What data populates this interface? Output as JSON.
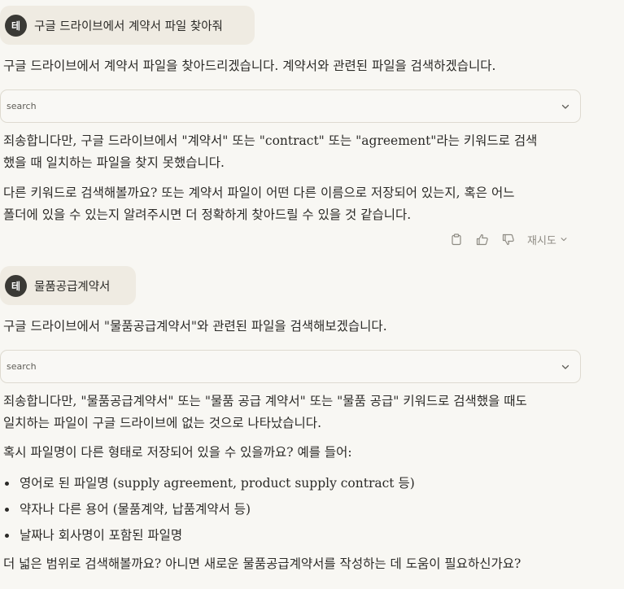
{
  "conversation": {
    "user_avatar_initial": "테",
    "turn1": {
      "user_message": "구글 드라이브에서 계약서 파일 찾아줘",
      "intro": "구글 드라이브에서 계약서 파일을 찾아드리겠습니다. 계약서와 관련된 파일을 검색하겠습니다.",
      "tool_label": "search",
      "result_line1": "죄송합니다만, 구글 드라이브에서 \"계약서\" 또는 \"contract\" 또는 \"agreement\"라는 키워드로 검색",
      "result_line2": "했을 때 일치하는 파일을 찾지 못했습니다.",
      "followup_line1": "다른 키워드로 검색해볼까요? 또는 계약서 파일이 어떤 다른 이름으로 저장되어 있는지, 혹은 어느",
      "followup_line2": "폴더에 있을 수 있는지 알려주시면 더 정확하게 찾아드릴 수 있을 것 같습니다.",
      "actions": {
        "copy_icon": "clipboard-icon",
        "like_icon": "thumbs-up-icon",
        "dislike_icon": "thumbs-down-icon",
        "retry_label": "재시도"
      }
    },
    "turn2": {
      "user_message": "물품공급계약서",
      "intro": "구글 드라이브에서 \"물품공급계약서\"와 관련된 파일을 검색해보겠습니다.",
      "tool_label": "search",
      "result_line1": "죄송합니다만, \"물품공급계약서\" 또는 \"물품 공급 계약서\" 또는 \"물품 공급\" 키워드로 검색했을 때도",
      "result_line2": "일치하는 파일이 구글 드라이브에 없는 것으로 나타났습니다.",
      "question": "혹시 파일명이 다른 형태로 저장되어 있을 수 있을까요? 예를 들어:",
      "bullets": [
        "영어로 된 파일명 (supply agreement, product supply contract 등)",
        "약자나 다른 용어 (물품계약, 납품계약서 등)",
        "날짜나 회사명이 포함된 파일명"
      ],
      "closing": "더 넓은 범위로 검색해볼까요? 아니면 새로운 물품공급계약서를 작성하는 데 도움이 필요하신가요?"
    }
  }
}
